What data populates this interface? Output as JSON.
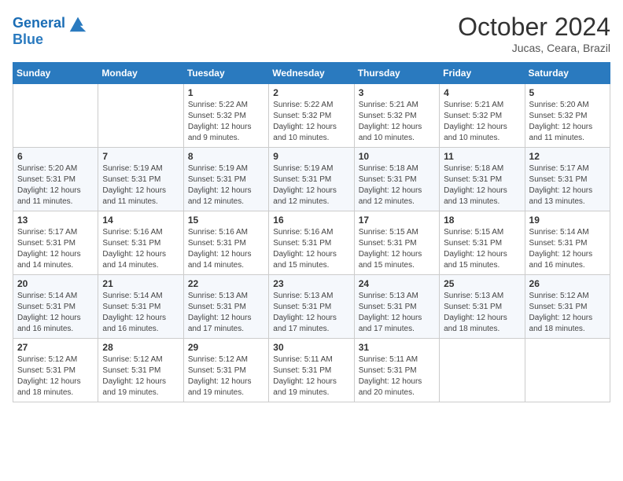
{
  "header": {
    "logo_line1": "General",
    "logo_line2": "Blue",
    "month": "October 2024",
    "location": "Jucas, Ceara, Brazil"
  },
  "weekdays": [
    "Sunday",
    "Monday",
    "Tuesday",
    "Wednesday",
    "Thursday",
    "Friday",
    "Saturday"
  ],
  "weeks": [
    [
      {
        "day": "",
        "info": ""
      },
      {
        "day": "",
        "info": ""
      },
      {
        "day": "1",
        "info": "Sunrise: 5:22 AM\nSunset: 5:32 PM\nDaylight: 12 hours\nand 9 minutes."
      },
      {
        "day": "2",
        "info": "Sunrise: 5:22 AM\nSunset: 5:32 PM\nDaylight: 12 hours\nand 10 minutes."
      },
      {
        "day": "3",
        "info": "Sunrise: 5:21 AM\nSunset: 5:32 PM\nDaylight: 12 hours\nand 10 minutes."
      },
      {
        "day": "4",
        "info": "Sunrise: 5:21 AM\nSunset: 5:32 PM\nDaylight: 12 hours\nand 10 minutes."
      },
      {
        "day": "5",
        "info": "Sunrise: 5:20 AM\nSunset: 5:32 PM\nDaylight: 12 hours\nand 11 minutes."
      }
    ],
    [
      {
        "day": "6",
        "info": "Sunrise: 5:20 AM\nSunset: 5:31 PM\nDaylight: 12 hours\nand 11 minutes."
      },
      {
        "day": "7",
        "info": "Sunrise: 5:19 AM\nSunset: 5:31 PM\nDaylight: 12 hours\nand 11 minutes."
      },
      {
        "day": "8",
        "info": "Sunrise: 5:19 AM\nSunset: 5:31 PM\nDaylight: 12 hours\nand 12 minutes."
      },
      {
        "day": "9",
        "info": "Sunrise: 5:19 AM\nSunset: 5:31 PM\nDaylight: 12 hours\nand 12 minutes."
      },
      {
        "day": "10",
        "info": "Sunrise: 5:18 AM\nSunset: 5:31 PM\nDaylight: 12 hours\nand 12 minutes."
      },
      {
        "day": "11",
        "info": "Sunrise: 5:18 AM\nSunset: 5:31 PM\nDaylight: 12 hours\nand 13 minutes."
      },
      {
        "day": "12",
        "info": "Sunrise: 5:17 AM\nSunset: 5:31 PM\nDaylight: 12 hours\nand 13 minutes."
      }
    ],
    [
      {
        "day": "13",
        "info": "Sunrise: 5:17 AM\nSunset: 5:31 PM\nDaylight: 12 hours\nand 14 minutes."
      },
      {
        "day": "14",
        "info": "Sunrise: 5:16 AM\nSunset: 5:31 PM\nDaylight: 12 hours\nand 14 minutes."
      },
      {
        "day": "15",
        "info": "Sunrise: 5:16 AM\nSunset: 5:31 PM\nDaylight: 12 hours\nand 14 minutes."
      },
      {
        "day": "16",
        "info": "Sunrise: 5:16 AM\nSunset: 5:31 PM\nDaylight: 12 hours\nand 15 minutes."
      },
      {
        "day": "17",
        "info": "Sunrise: 5:15 AM\nSunset: 5:31 PM\nDaylight: 12 hours\nand 15 minutes."
      },
      {
        "day": "18",
        "info": "Sunrise: 5:15 AM\nSunset: 5:31 PM\nDaylight: 12 hours\nand 15 minutes."
      },
      {
        "day": "19",
        "info": "Sunrise: 5:14 AM\nSunset: 5:31 PM\nDaylight: 12 hours\nand 16 minutes."
      }
    ],
    [
      {
        "day": "20",
        "info": "Sunrise: 5:14 AM\nSunset: 5:31 PM\nDaylight: 12 hours\nand 16 minutes."
      },
      {
        "day": "21",
        "info": "Sunrise: 5:14 AM\nSunset: 5:31 PM\nDaylight: 12 hours\nand 16 minutes."
      },
      {
        "day": "22",
        "info": "Sunrise: 5:13 AM\nSunset: 5:31 PM\nDaylight: 12 hours\nand 17 minutes."
      },
      {
        "day": "23",
        "info": "Sunrise: 5:13 AM\nSunset: 5:31 PM\nDaylight: 12 hours\nand 17 minutes."
      },
      {
        "day": "24",
        "info": "Sunrise: 5:13 AM\nSunset: 5:31 PM\nDaylight: 12 hours\nand 17 minutes."
      },
      {
        "day": "25",
        "info": "Sunrise: 5:13 AM\nSunset: 5:31 PM\nDaylight: 12 hours\nand 18 minutes."
      },
      {
        "day": "26",
        "info": "Sunrise: 5:12 AM\nSunset: 5:31 PM\nDaylight: 12 hours\nand 18 minutes."
      }
    ],
    [
      {
        "day": "27",
        "info": "Sunrise: 5:12 AM\nSunset: 5:31 PM\nDaylight: 12 hours\nand 18 minutes."
      },
      {
        "day": "28",
        "info": "Sunrise: 5:12 AM\nSunset: 5:31 PM\nDaylight: 12 hours\nand 19 minutes."
      },
      {
        "day": "29",
        "info": "Sunrise: 5:12 AM\nSunset: 5:31 PM\nDaylight: 12 hours\nand 19 minutes."
      },
      {
        "day": "30",
        "info": "Sunrise: 5:11 AM\nSunset: 5:31 PM\nDaylight: 12 hours\nand 19 minutes."
      },
      {
        "day": "31",
        "info": "Sunrise: 5:11 AM\nSunset: 5:31 PM\nDaylight: 12 hours\nand 20 minutes."
      },
      {
        "day": "",
        "info": ""
      },
      {
        "day": "",
        "info": ""
      }
    ]
  ]
}
